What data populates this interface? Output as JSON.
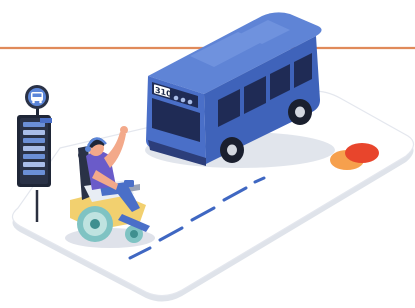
{
  "illustration": {
    "bus": {
      "route_number": "310"
    },
    "icons": {
      "bus_stop_sign": "bus-icon",
      "card_logo": "card-brand-circles"
    },
    "colors": {
      "accent_line": "#e08a5a",
      "bus_body": "#4a6fc8",
      "bus_dark": "#3556a8",
      "road_dashes": "#3f67c2",
      "card_logo_red": "#e8452c",
      "card_logo_orange": "#f6a04d",
      "wheelchair": "#7fc3c3",
      "person_shirt": "#6a5bc9"
    }
  }
}
